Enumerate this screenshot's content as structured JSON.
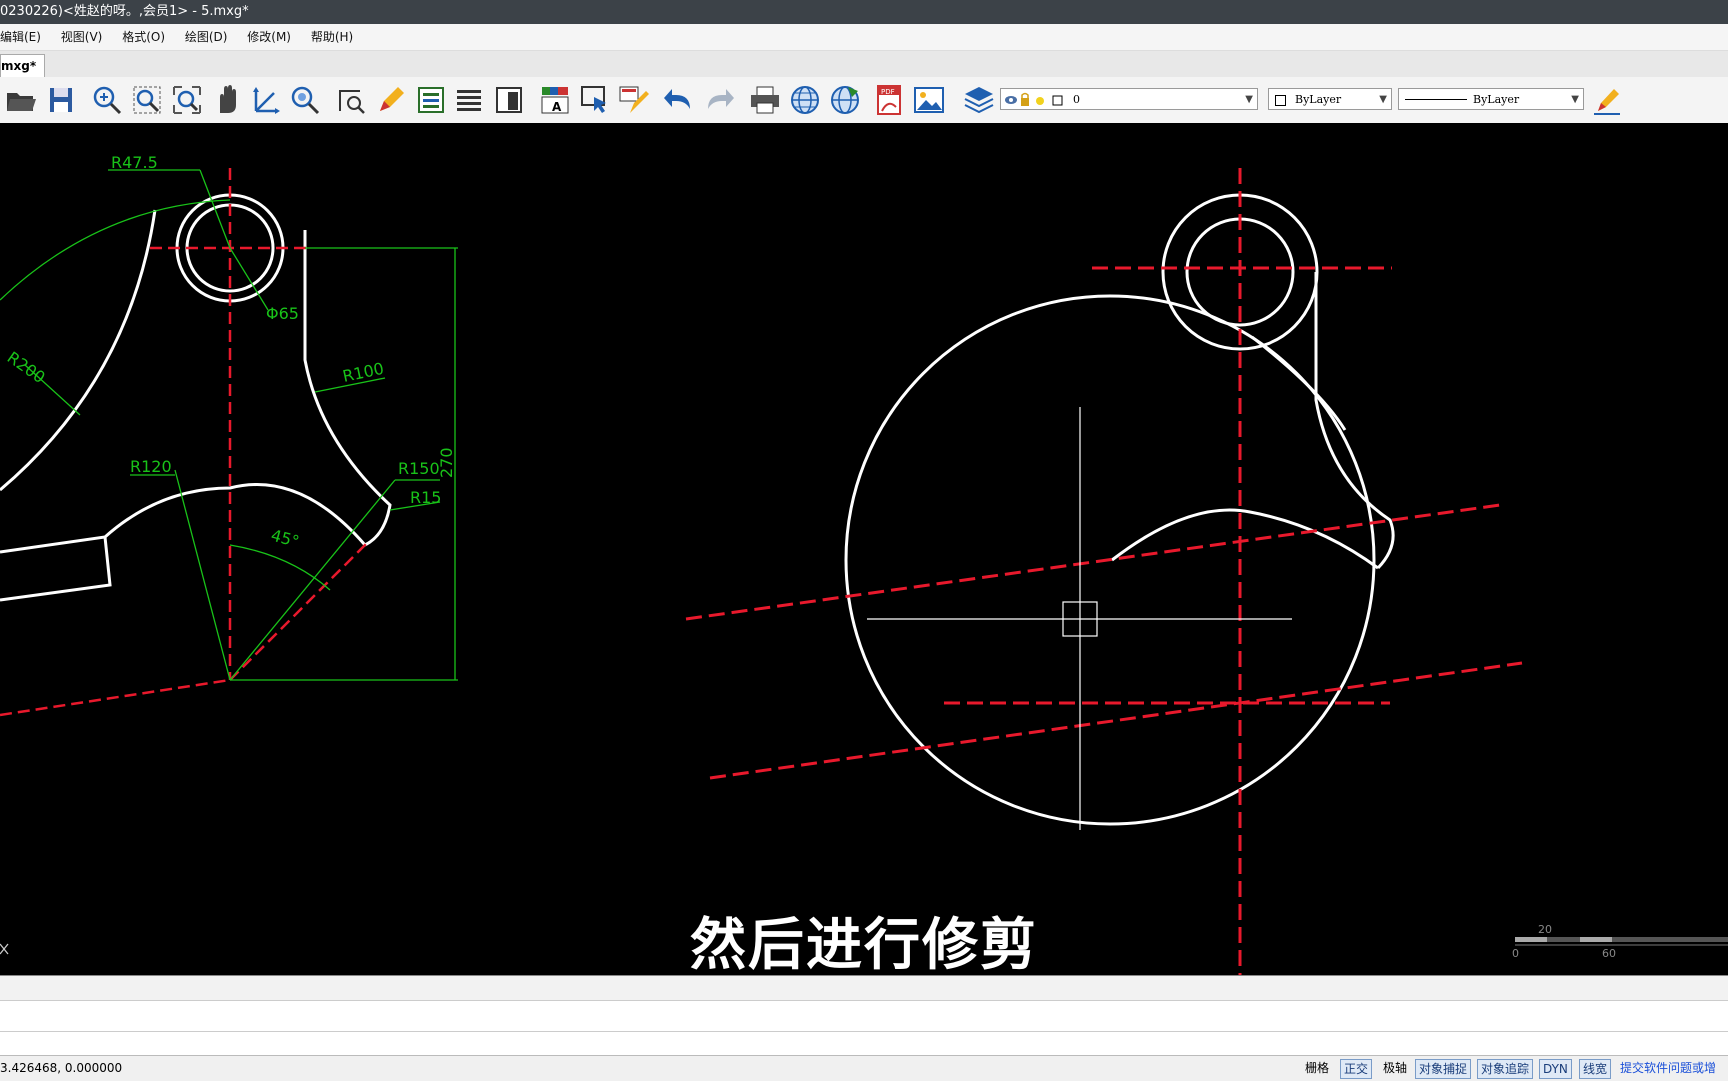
{
  "window": {
    "title": "0230226)<姓赵的呀。,会员1> - 5.mxg*"
  },
  "menu": [
    "编辑(E)",
    "视图(V)",
    "格式(O)",
    "绘图(D)",
    "修改(M)",
    "帮助(H)"
  ],
  "tabs": [
    {
      "label": "mxg*"
    }
  ],
  "toolbar": {
    "layer_value": "0",
    "color_value": "ByLayer",
    "linetype_value": "ByLayer"
  },
  "drawing_labels": {
    "r47_5": "R47.5",
    "phi65": "Φ65",
    "r200": "R200",
    "r100": "R100",
    "r120": "R120",
    "r150": "R150",
    "r15": "R15",
    "angle45": "45°",
    "dim270": "270",
    "scale_20": "20",
    "scale_0": "0",
    "scale_60": "60"
  },
  "subtitle": "然后进行修剪",
  "status": {
    "coords": "3.426468,  0.000000",
    "toggles": [
      {
        "label": "栅格",
        "on": false
      },
      {
        "label": "正交",
        "on": true
      },
      {
        "label": "极轴",
        "on": false
      },
      {
        "label": "对象捕捉",
        "on": true
      },
      {
        "label": "对象追踪",
        "on": true
      },
      {
        "label": "DYN",
        "on": true
      },
      {
        "label": "线宽",
        "on": true
      }
    ],
    "feedback_link": "提交软件问题或增"
  },
  "colors": {
    "canvas_bg": "#000000",
    "geometry": "#ffffff",
    "centerline": "#e8192c",
    "dimension": "#19c219"
  }
}
